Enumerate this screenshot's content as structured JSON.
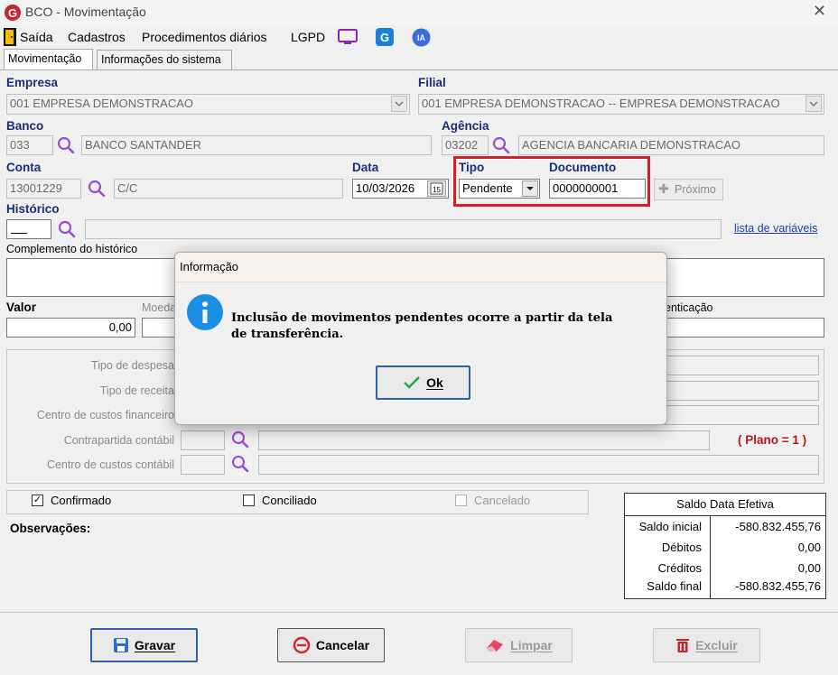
{
  "window": {
    "title": "BCO - Movimentação",
    "logo_letter": "G"
  },
  "menu": {
    "saida": "Saída",
    "cadastros": "Cadastros",
    "procedimentos": "Procedimentos diários",
    "lgpd": "LGPD",
    "g_badge": "G",
    "ia_badge": "IA"
  },
  "tabs": [
    "Movimentação",
    "Informações do sistema"
  ],
  "form": {
    "empresa_label": "Empresa",
    "empresa_value": "001 EMPRESA DEMONSTRACAO",
    "filial_label": "Filial",
    "filial_value": "001 EMPRESA DEMONSTRACAO -- EMPRESA DEMONSTRACAO",
    "banco_label": "Banco",
    "banco_code": "033",
    "banco_name": "BANCO SANTANDER",
    "agencia_label": "Agência",
    "agencia_code": "03202",
    "agencia_name": "AGENCIA BANCARIA DEMONSTRACAO",
    "conta_label": "Conta",
    "conta_code": "13001229",
    "conta_name": "C/C",
    "data_label": "Data",
    "data_value": "10/03/2026",
    "calendar_day": "15",
    "tipo_label": "Tipo",
    "tipo_value": "Pendente",
    "documento_label": "Documento",
    "documento_value": "0000000001",
    "proximo_label": "Próximo",
    "historico_label": "Histórico",
    "lista_variaveis": "lista de variáveis",
    "complemento_label": "Complemento do histórico",
    "valor_label": "Valor",
    "valor_value": "0,00",
    "moeda_label": "Moeda",
    "autenticacao_label": "enticação"
  },
  "classificacao": {
    "tipo_despesa": "Tipo de despesa",
    "tipo_receita": "Tipo de receita",
    "centro_fin": "Centro de custos financeiro",
    "contrapartida": "Contrapartida contábil",
    "centro_cont": "Centro de custos contábil",
    "plano": "( Plano = 1 )"
  },
  "flags": {
    "confirmado": "Confirmado",
    "conciliado": "Conciliado",
    "cancelado": "Cancelado",
    "check_mark": "✓"
  },
  "observacoes_label": "Observações:",
  "saldo": {
    "header": "Saldo Data Efetiva",
    "rows": [
      {
        "label": "Saldo inicial",
        "value": "-580.832.455,76"
      },
      {
        "label": "Débitos",
        "value": "0,00"
      },
      {
        "label": "Créditos",
        "value": "0,00"
      },
      {
        "label": "Saldo final",
        "value": "-580.832.455,76"
      }
    ]
  },
  "buttons": {
    "gravar": "Gravar",
    "cancelar": "Cancelar",
    "limpar": "Limpar",
    "excluir": "Excluir"
  },
  "dialog": {
    "title": "Informação",
    "message": "Inclusão de movimentos pendentes ocorre a partir da tela de transferência.",
    "ok": "Ok"
  },
  "colors": {
    "label_blue": "#1a2e78",
    "highlight_red": "#d0202a",
    "link": "#1a3fb0",
    "plano_red": "#b01818",
    "magnifier": "#9a4fd0"
  }
}
